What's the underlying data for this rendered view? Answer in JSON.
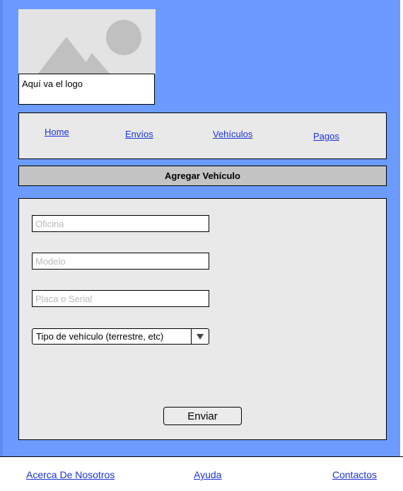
{
  "logo": {
    "placeholder_icon": "image-placeholder-icon",
    "caption": "Aquí va el logo"
  },
  "nav": {
    "home": "Home",
    "envios": "Envíos",
    "vehiculos": "Vehículos",
    "pagos": "Pagos"
  },
  "section": {
    "title": "Agregar Vehículo"
  },
  "form": {
    "oficina_placeholder": "Oficina",
    "modelo_placeholder": "Modelo",
    "placa_placeholder": "Placa o Serial",
    "tipo_selected": "Tipo de vehículo (terrestre, etc)",
    "submit_label": "Enviar"
  },
  "footer": {
    "about": "Acerca De Nosotros",
    "help": "Ayuda",
    "contacts": "Contactos"
  },
  "colors": {
    "page_background": "#6b9bff",
    "panel_background": "#e9e9e9",
    "header_background": "#c4c4c4",
    "link": "#1a33d6"
  }
}
